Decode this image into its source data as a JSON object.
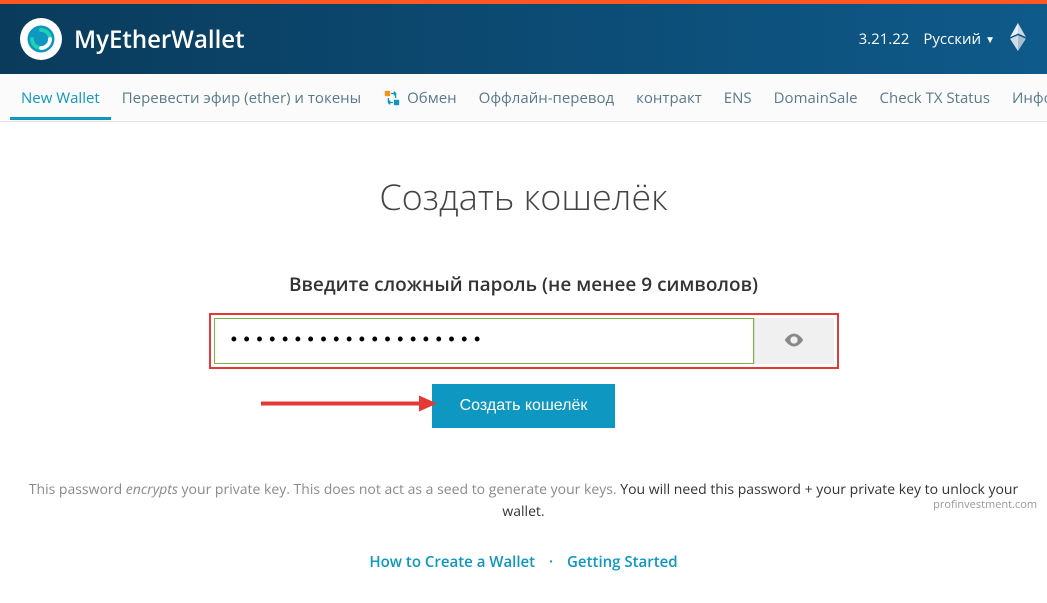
{
  "header": {
    "brand": "MyEtherWallet",
    "version": "3.21.22",
    "language": "Русский"
  },
  "nav": {
    "items": [
      "New Wallet",
      "Перевести эфир (ether) и токены",
      "Обмен",
      "Оффлайн-перевод",
      "контракт",
      "ENS",
      "DomainSale",
      "Check TX Status",
      "Информация о кошельк"
    ]
  },
  "main": {
    "title": "Создать кошелёк",
    "subtitle": "Введите сложный пароль (не менее 9 символов)",
    "password_value": "••••••••••••••••••••",
    "create_button": "Создать кошелёк"
  },
  "info": {
    "part1": "This password ",
    "em": "encrypts",
    "part2": " your private key. This does not act as a seed to generate your keys. ",
    "strong": "You will need this password + your private key to unlock your wallet."
  },
  "links": {
    "howto": "How to Create a Wallet",
    "getting_started": "Getting Started"
  },
  "watermark": "profinvestment.com"
}
